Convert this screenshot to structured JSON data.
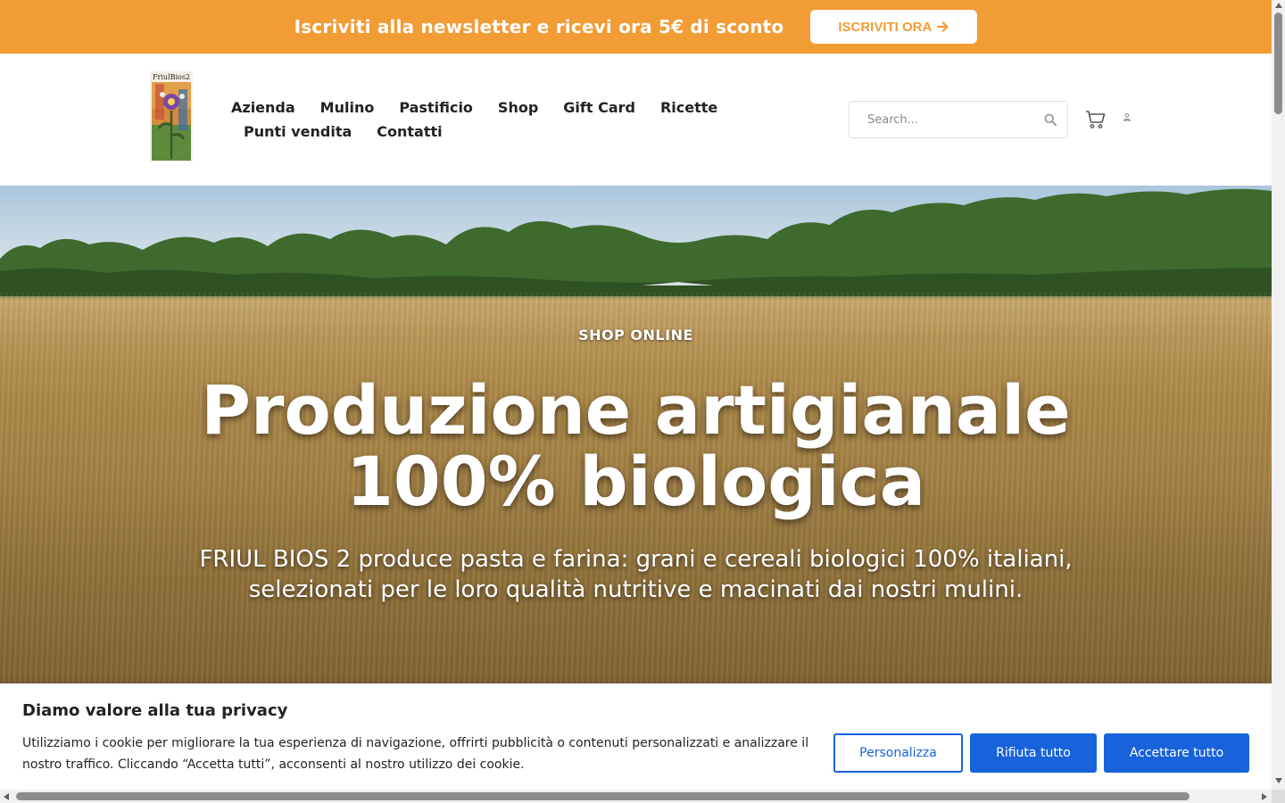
{
  "promo": {
    "text": "Iscriviti alla newsletter e ricevi ora 5€ di sconto",
    "button_label": "ISCRIVITI ORA",
    "button_icon": "arrow-right-icon",
    "color": "#f29c35"
  },
  "header": {
    "logo_alt": "FriulBios2",
    "nav": {
      "row1": [
        "Azienda",
        "Mulino",
        "Pastificio",
        "Shop",
        "Gift Card",
        "Ricette"
      ],
      "row2": [
        "Punti vendita",
        "Contatti"
      ]
    },
    "search": {
      "placeholder": "Search...",
      "icon": "search-icon"
    },
    "cart_icon": "cart-icon",
    "user_icon": "user-icon"
  },
  "hero": {
    "kicker": "SHOP ONLINE",
    "title_line1": "Produzione artigianale",
    "title_line2": "100% biologica",
    "subtitle": "FRIUL BIOS 2 produce pasta e farina: grani e cereali biologici 100% italiani, selezionati per le loro qualità nutritive e macinati dai nostri mulini."
  },
  "cookie": {
    "title": "Diamo valore alla tua privacy",
    "text": "Utilizziamo i cookie per migliorare la tua esperienza di navigazione, offrirti pubblicità o contenuti personalizzati e analizzare il nostro traffico. Cliccando “Accetta tutti”, acconsenti al nostro utilizzo dei cookie.",
    "customize_label": "Personalizza",
    "reject_label": "Rifiuta tutto",
    "accept_label": "Accettare tutto",
    "accent_color": "#1863dc"
  }
}
